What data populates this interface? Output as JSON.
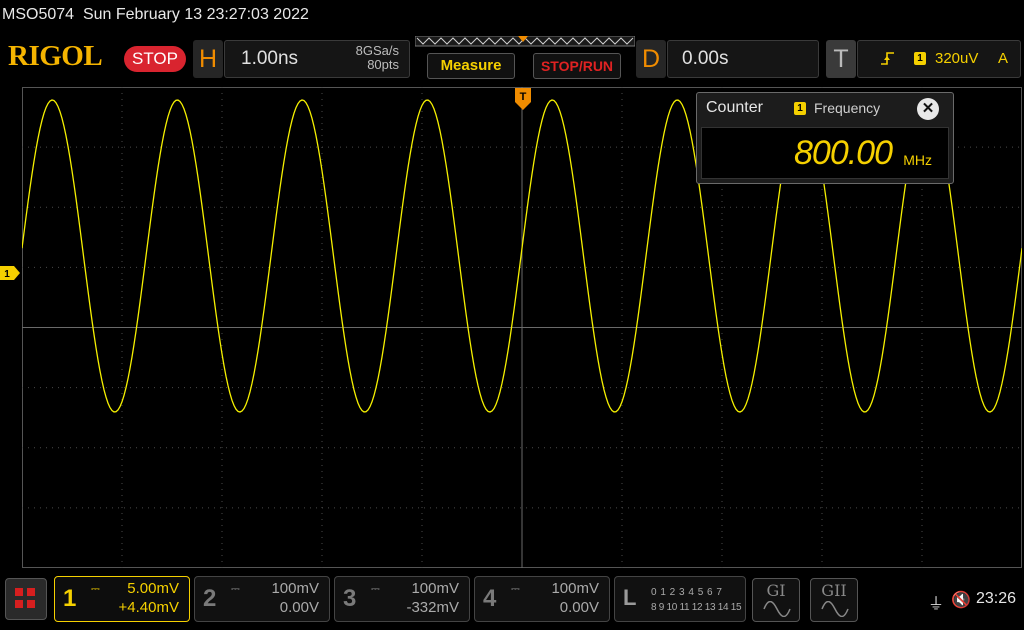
{
  "title_bar": {
    "model": "MSO5074",
    "datetime": "Sun February 13 23:27:03 2022"
  },
  "toolbar": {
    "logo": "RIGOL",
    "run_state": "STOP",
    "horizontal": {
      "letter": "H",
      "timebase": "1.00ns",
      "sample_rate": "8GSa/s",
      "memory_depth": "80pts"
    },
    "measure_label": "Measure",
    "stop_run_label": "STOP/RUN",
    "delay": {
      "letter": "D",
      "value": "0.00s"
    },
    "trigger": {
      "letter": "T",
      "edge_symbol": "⌐",
      "source_channel": "1",
      "level": "320uV",
      "mode": "A"
    }
  },
  "screen": {
    "channel1_marker": "1",
    "trigger_marker": "T",
    "trace_color": "#f5f000",
    "waveform": {
      "type": "sine",
      "frequency": "800.00MHz",
      "cycles_visible": 8,
      "description_channel": "1"
    }
  },
  "counter_panel": {
    "title": "Counter",
    "source_channel": "1",
    "measure_type": "Frequency",
    "value": "800.00",
    "unit": "MHz",
    "close_icon": "close-icon"
  },
  "channels": [
    {
      "num": "1",
      "coupling": "DC",
      "scale": "5.00mV",
      "offset": "+4.40mV",
      "active": true
    },
    {
      "num": "2",
      "coupling": "DC",
      "scale": "100mV",
      "offset": "0.00V",
      "active": false
    },
    {
      "num": "3",
      "coupling": "DC",
      "scale": "100mV",
      "offset": "-332mV",
      "active": false
    },
    {
      "num": "4",
      "coupling": "DC",
      "scale": "100mV",
      "offset": "0.00V",
      "active": false
    }
  ],
  "logic": {
    "letter": "L",
    "row1": "0 1 2 3  4 5 6 7",
    "row2": "8 9 10 11 12 13 14 15"
  },
  "generators": [
    {
      "label": "GI"
    },
    {
      "label": "GII"
    }
  ],
  "status": {
    "usb_icon": "usb-icon",
    "mute_icon": "speaker-mute-icon",
    "time": "23:26"
  },
  "colors": {
    "brand": "#f5b400",
    "accent_orange": "#f08c00",
    "channel1": "#f5d000",
    "stop_red": "#d9242f"
  }
}
